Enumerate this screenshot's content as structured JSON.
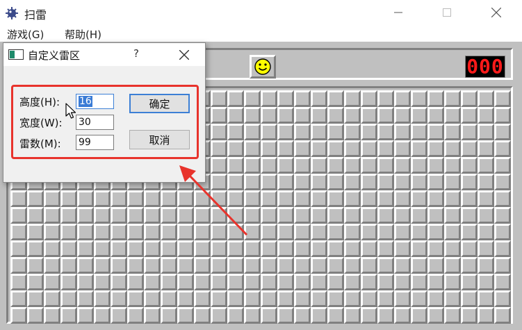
{
  "window": {
    "title": "扫雷",
    "icon": "mine-icon"
  },
  "menu": {
    "items": [
      {
        "label": "游戏(G)"
      },
      {
        "label": "帮助(H)"
      }
    ]
  },
  "game": {
    "smiley": "smiley-face-icon",
    "mine_counter": "000",
    "grid_rows": 14,
    "grid_cols": 30
  },
  "dialog": {
    "title": "自定义雷区",
    "help_label": "?",
    "fields": {
      "height": {
        "label": "高度(H):",
        "value": "16"
      },
      "width": {
        "label": "宽度(W):",
        "value": "30"
      },
      "mines": {
        "label": "雷数(M):",
        "value": "99"
      }
    },
    "ok_label": "确定",
    "cancel_label": "取消"
  },
  "colors": {
    "annotation": "#e8332c",
    "panel": "#c0c0c0",
    "counter_digits": "#ff1a1a",
    "focus": "#3c7fd5"
  }
}
